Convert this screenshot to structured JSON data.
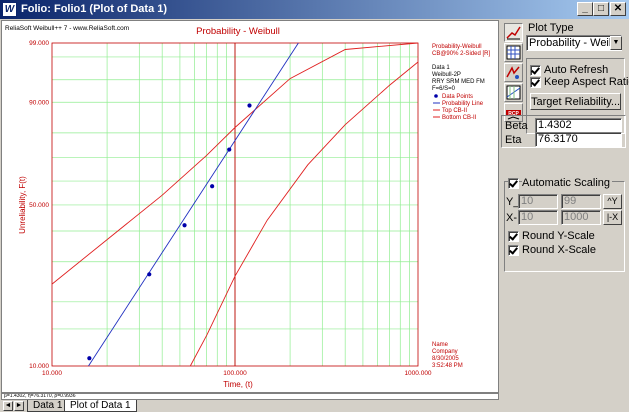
{
  "window": {
    "title": "Folio: Folio1 (Plot of Data 1)",
    "app_icon_letter": "W",
    "buttons": {
      "minimize": "_",
      "maximize": "□",
      "close": "✕"
    }
  },
  "plot": {
    "header_text": "ReliaSoft Weibull++ 7 - www.ReliaSoft.com",
    "legend": {
      "title_line1": "Probability-Weibull",
      "title_line2": "CB@90% 2-Sided [R]",
      "dataset_name": "Data 1",
      "dataset_lines": [
        "Weibull-2P",
        "RRY SRM MED FM",
        "F=6/S=0"
      ],
      "entries": [
        {
          "label": "Data Points",
          "color": "#0000aa",
          "kind": "dot"
        },
        {
          "label": "Probability Line",
          "color": "#2030c0",
          "kind": "line"
        },
        {
          "label": "Top CB-II",
          "color": "#e02020",
          "kind": "line"
        },
        {
          "label": "Bottom CB-II",
          "color": "#e02020",
          "kind": "line"
        }
      ]
    },
    "footer": {
      "name": "Name",
      "company": "Company",
      "date": "8/30/2005",
      "time": "3:52:48 PM"
    }
  },
  "chart_data": {
    "type": "scatter",
    "title": "Probability - Weibull",
    "xlabel": "Time, (t)",
    "ylabel": "Unreliability, F(t)",
    "x_scale": "log",
    "y_scale": "weibull-probability",
    "xlim": [
      10,
      1000
    ],
    "ylim": [
      10,
      99
    ],
    "x_tick_labels": [
      "10.000",
      "100.000",
      "1000.000"
    ],
    "y_tick_labels": [
      "10.000",
      "50.000",
      "90.000",
      "99.000"
    ],
    "grid": true,
    "colors": {
      "grid": "#90ee90",
      "axis_text": "#c00000",
      "points": "#0000aa",
      "fit_line": "#2030c0",
      "bounds": "#e02020"
    },
    "series": [
      {
        "name": "Data Points",
        "points": [
          {
            "x": 16.0,
            "y": 10.9
          },
          {
            "x": 34.0,
            "y": 26.5
          },
          {
            "x": 53.0,
            "y": 42.1
          },
          {
            "x": 75.0,
            "y": 57.8
          },
          {
            "x": 93.0,
            "y": 73.4
          },
          {
            "x": 120.0,
            "y": 89.1
          }
        ]
      }
    ],
    "fit": {
      "beta": 1.4302,
      "eta": 76.317
    },
    "confidence_bounds": {
      "upper": [
        {
          "x": 10,
          "y": 24.0
        },
        {
          "x": 20,
          "y": 37.0
        },
        {
          "x": 40,
          "y": 54.0
        },
        {
          "x": 70,
          "y": 71.0
        },
        {
          "x": 100,
          "y": 82.0
        },
        {
          "x": 200,
          "y": 95.2
        },
        {
          "x": 400,
          "y": 98.6
        },
        {
          "x": 1000,
          "y": 99.0
        }
      ],
      "lower": [
        {
          "x": 57,
          "y": 10.0
        },
        {
          "x": 70,
          "y": 14.0
        },
        {
          "x": 100,
          "y": 26.0
        },
        {
          "x": 150,
          "y": 44.0
        },
        {
          "x": 250,
          "y": 67.0
        },
        {
          "x": 400,
          "y": 83.0
        },
        {
          "x": 700,
          "y": 94.0
        },
        {
          "x": 1000,
          "y": 97.5
        }
      ]
    }
  },
  "panel": {
    "plot_type_label": "Plot Type",
    "plot_type_value": "Probability - Weibull",
    "auto_refresh_label": "Auto Refresh",
    "auto_refresh": true,
    "keep_aspect_label": "Keep Aspect Ratio",
    "keep_aspect": true,
    "target_reliability_label": "Target Reliability...",
    "beta_label": "Beta",
    "beta_value": "1.4302",
    "eta_label": "Eta",
    "eta_value": "76.3170",
    "auto_scaling_label": "Automatic Scaling",
    "auto_scaling": true,
    "y_axis_label": "Y_",
    "y_min": "10",
    "y_max": "99",
    "y_btn": "^Y",
    "x_axis_label": "X-|",
    "x_min": "10",
    "x_max": "1000",
    "x_btn": "|-X",
    "round_y_label": "Round Y-Scale",
    "round_y": true,
    "round_x_label": "Round X-Scale",
    "round_x": true
  },
  "status_text": "β=1.4302, η=76.3170, ρ=0.9936",
  "tabs": [
    {
      "label": "Data 1",
      "active": false
    },
    {
      "label": "Plot of Data 1",
      "active": true
    }
  ],
  "tab_nav": {
    "prev": "◄",
    "next": "►"
  }
}
